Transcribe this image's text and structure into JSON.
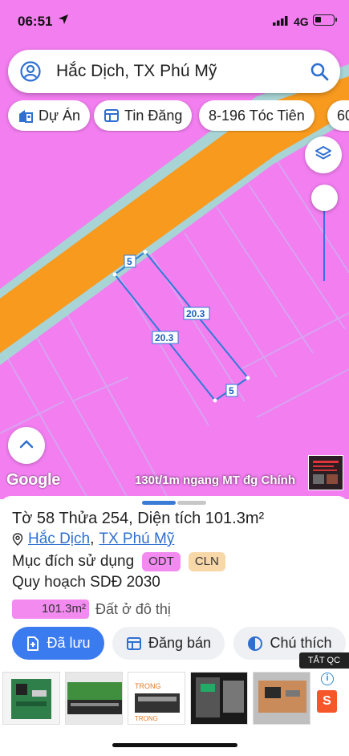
{
  "status_bar": {
    "time": "06:51",
    "network": "4G"
  },
  "search": {
    "query": "Hắc Dịch, TX Phú Mỹ"
  },
  "chips": [
    {
      "label": "Dự Án",
      "icon": "building-icon"
    },
    {
      "label": "Tin Đăng",
      "icon": "listing-icon"
    },
    {
      "label": "8-196 Tóc Tiên"
    },
    {
      "label": "60"
    }
  ],
  "map": {
    "dimension_labels": [
      "5",
      "20.3",
      "20.3",
      "5"
    ],
    "caption": "130t/1m ngang MT đg Chính",
    "attribution": "Google",
    "colors": {
      "zone": "#f27ef0",
      "road": "#f79a1e",
      "parcel_outline": "#2e7bd6"
    }
  },
  "sheet": {
    "title_prefix": "Tờ",
    "sheet_no": "58",
    "parcel_prefix": "Thửa",
    "parcel_no": "254",
    "area_label": "Diện tích",
    "area_value": "101.3m²",
    "address_part1": "Hắc Dịch",
    "address_sep": ",",
    "address_part2": "TX Phú Mỹ",
    "purpose_label": "Mục đích sử dụng",
    "badges": [
      "ODT",
      "CLN"
    ],
    "plan_label": "Quy hoạch SDĐ 2030",
    "area_box": "101.3m²",
    "area_desc": "Đất ở đô thị"
  },
  "actions": {
    "saved": "Đã lưu",
    "post": "Đăng bán",
    "legend": "Chú thích"
  },
  "ads": {
    "tag": "TẮT QC",
    "info": "i",
    "shop": "S"
  }
}
